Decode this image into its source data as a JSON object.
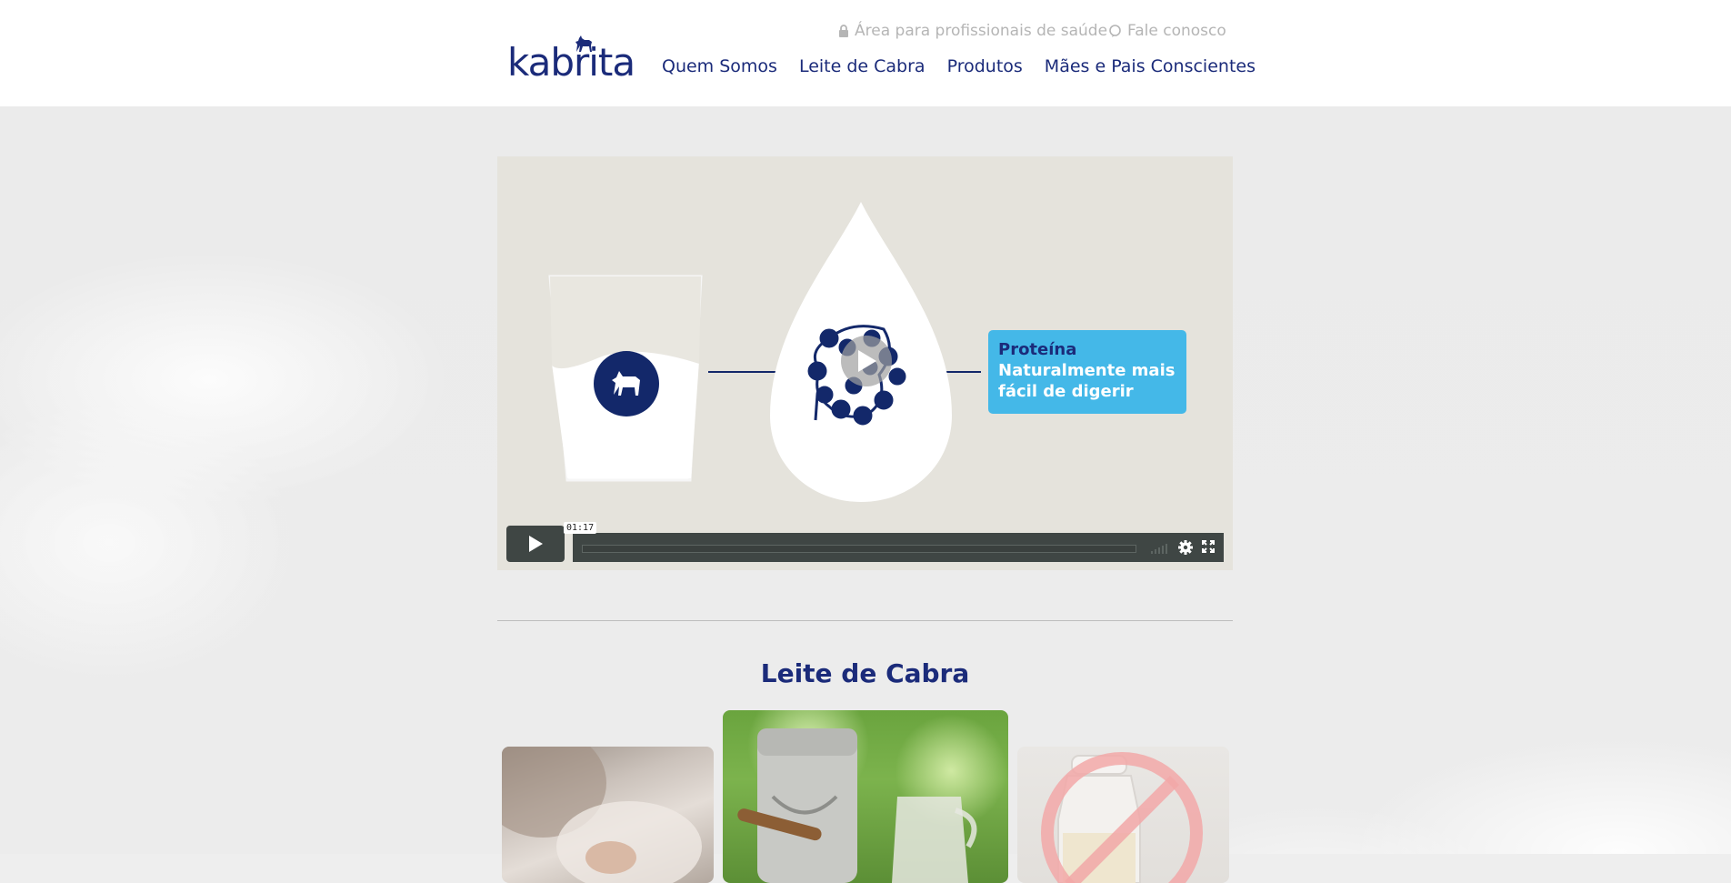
{
  "header": {
    "logo_text": "kabrita",
    "utility_links": [
      {
        "label": "Área para profissionais de saúde",
        "icon": "lock-icon"
      },
      {
        "label": "Fale conosco",
        "icon": "chat-bubble-icon"
      }
    ],
    "nav": [
      "Quem Somos",
      "Leite de Cabra",
      "Produtos",
      "Mães e Pais Conscientes"
    ]
  },
  "video": {
    "callout_title": "Proteína",
    "callout_text": "Naturalmente mais fácil de digerir",
    "time": "01:17",
    "colors": {
      "navy": "#1b2b7a",
      "callout": "#44b8e8",
      "background": "#e5e3dc"
    }
  },
  "section": {
    "title": "Leite de Cabra"
  },
  "colors": {
    "brand": "#1b2b7a",
    "muted_link": "#b5b5b5"
  }
}
